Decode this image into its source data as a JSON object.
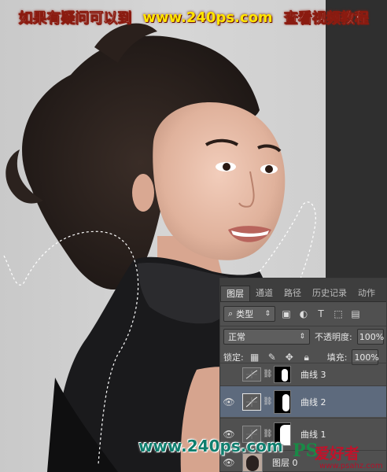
{
  "banner": {
    "left_text": "如果有疑问可以到",
    "url": "www.240ps.com",
    "right_text": "查看视频教程"
  },
  "layers_panel": {
    "tabs": [
      {
        "label": "图层",
        "active": true
      },
      {
        "label": "通道",
        "active": false
      },
      {
        "label": "路径",
        "active": false
      },
      {
        "label": "历史记录",
        "active": false
      },
      {
        "label": "动作",
        "active": false
      }
    ],
    "filter_kind": "类型",
    "blend_mode": "正常",
    "opacity_label": "不透明度:",
    "opacity_value": "100%",
    "lock_label": "锁定:",
    "fill_label": "填充:",
    "fill_value": "100%",
    "layers": [
      {
        "name": "曲线 3",
        "visible": false,
        "selected": false
      },
      {
        "name": "曲线 2",
        "visible": true,
        "selected": true
      },
      {
        "name": "曲线 1",
        "visible": true,
        "selected": false
      },
      {
        "name": "图层 0",
        "visible": true,
        "selected": false
      }
    ]
  },
  "watermark": {
    "url": "www.240ps.com",
    "logo_ps": "PS",
    "logo_cn": "爱好者",
    "logo_domain": "www.psahz.com"
  },
  "colors": {
    "banner_text": "#ffffff",
    "banner_url": "#ffe600",
    "panel_bg": "#505050",
    "selected_layer": "#5d6a7d",
    "watermark_url": "#0f7e6e"
  }
}
